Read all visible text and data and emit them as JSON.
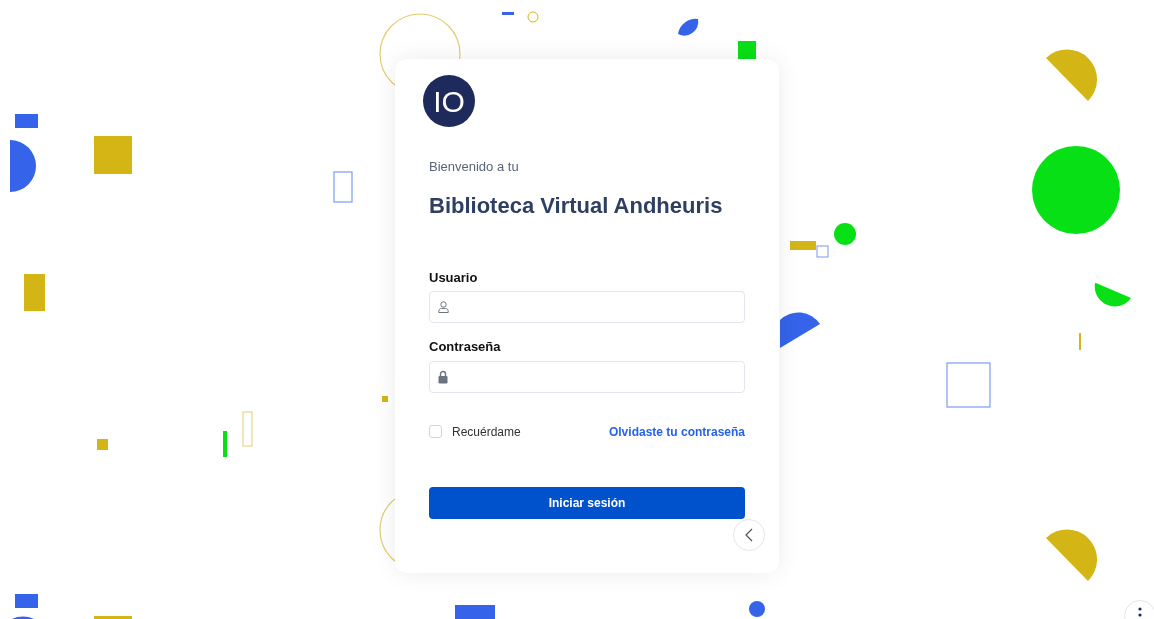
{
  "logo": {
    "text": "IO"
  },
  "welcome": "Bienvenido a tu",
  "title": "Biblioteca Virtual Andheuris",
  "fields": [
    {
      "kind": "user",
      "label": "Usuario"
    },
    {
      "kind": "password",
      "label": "Contraseña"
    }
  ],
  "remember": {
    "label": "Recuérdame",
    "checked": false
  },
  "forgot_link": "Olvidaste tu contraseña",
  "submit": "Iniciar sesión"
}
